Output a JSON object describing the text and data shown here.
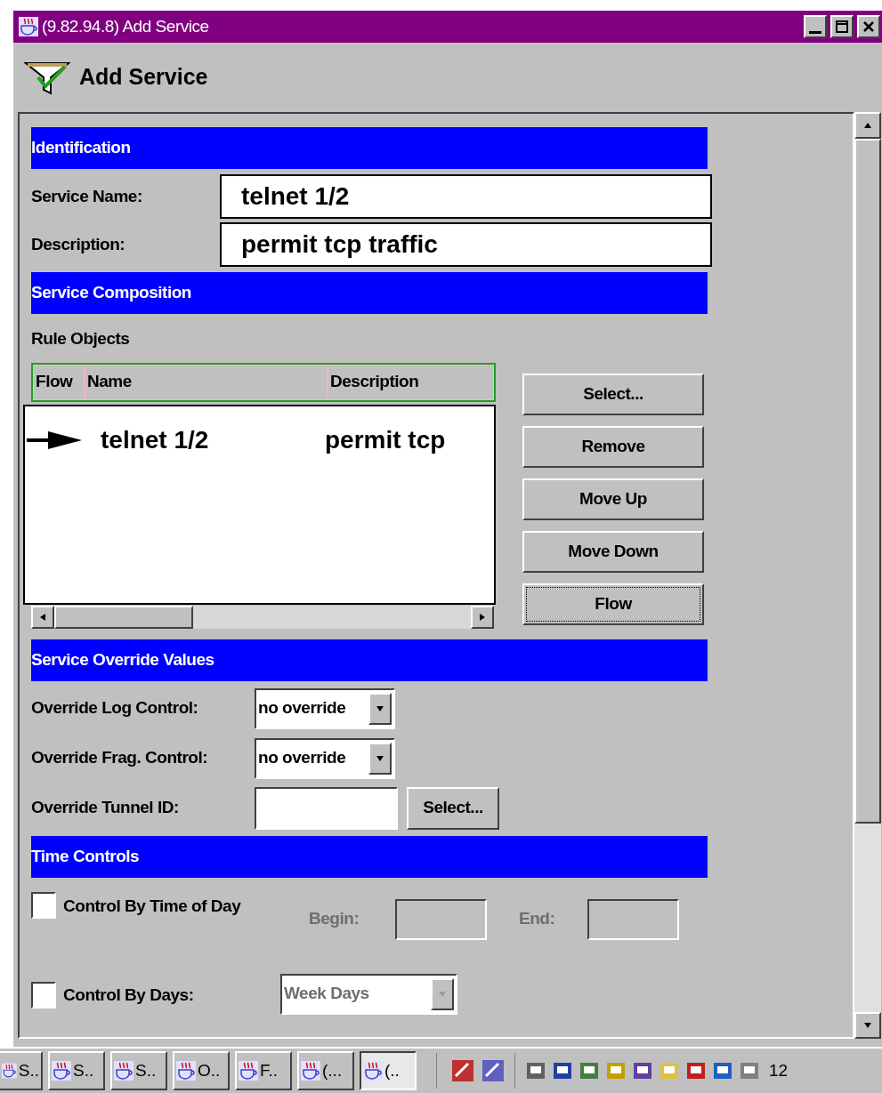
{
  "window": {
    "title": "(9.82.94.8) Add Service"
  },
  "header": {
    "title": "Add Service"
  },
  "identification": {
    "heading": "Identification",
    "fields": [
      {
        "label": "Service Name:",
        "value": "telnet 1/2"
      },
      {
        "label": "Description:",
        "value": "permit tcp traffic"
      }
    ]
  },
  "composition": {
    "heading": "Service Composition",
    "caption": "Rule Objects",
    "columns": [
      "Flow",
      "Name",
      "Description"
    ],
    "rows": [
      {
        "flow": true,
        "name": "telnet 1/2",
        "description": "permit tcp"
      }
    ],
    "buttons": [
      {
        "label": "Select...",
        "focused": false
      },
      {
        "label": "Remove",
        "focused": false
      },
      {
        "label": "Move Up",
        "focused": false
      },
      {
        "label": "Move Down",
        "focused": false
      },
      {
        "label": "Flow",
        "focused": true
      }
    ]
  },
  "overrides": {
    "heading": "Service Override Values",
    "rows": [
      {
        "kind": "dropdown",
        "label": "Override Log Control:",
        "value": "no override"
      },
      {
        "kind": "dropdown",
        "label": "Override Frag. Control:",
        "value": "no override"
      },
      {
        "kind": "field",
        "label": "Override Tunnel ID:",
        "button": "Select..."
      }
    ]
  },
  "time_controls": {
    "heading": "Time Controls",
    "rows": [
      {
        "kind": "time",
        "label": "Control By Time of Day",
        "checked": false,
        "begin": {
          "label": "Begin:",
          "disabled": true
        },
        "end": {
          "label": "End:",
          "disabled": true
        }
      },
      {
        "kind": "days",
        "label": "Control By Days:",
        "checked": false,
        "dropdown": {
          "value": "Week Days",
          "disabled": true
        }
      }
    ]
  },
  "taskbar": {
    "items": [
      {
        "label": "S..",
        "selected": false
      },
      {
        "label": "S..",
        "selected": false
      },
      {
        "label": "S..",
        "selected": false
      },
      {
        "label": "O..",
        "selected": false
      },
      {
        "label": "F..",
        "selected": false
      },
      {
        "label": "(...",
        "selected": false
      },
      {
        "label": "(..",
        "selected": true
      }
    ],
    "clock": "12"
  }
}
